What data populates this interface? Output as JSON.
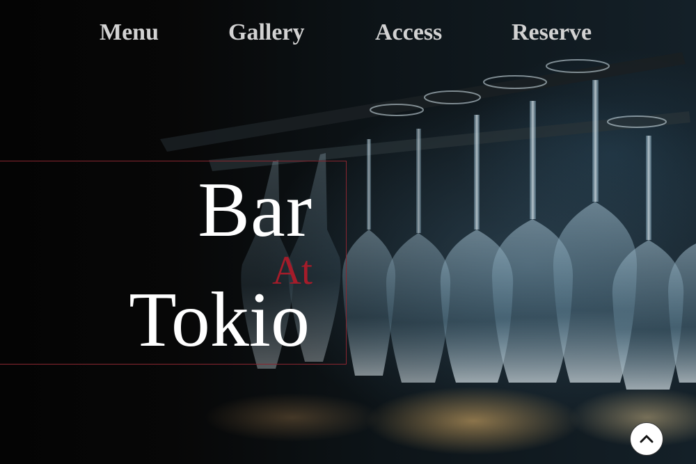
{
  "nav": {
    "items": [
      {
        "label": "Menu"
      },
      {
        "label": "Gallery"
      },
      {
        "label": "Access"
      },
      {
        "label": "Reserve"
      }
    ]
  },
  "hero": {
    "logo_line1": "Bar",
    "logo_line2": "At",
    "logo_line3": "Tokio",
    "background": "bar-wine-glasses-photo"
  },
  "back_to_top": {
    "icon": "chevron-up-icon"
  },
  "colors": {
    "background": "#050505",
    "nav_text": "#d2d2d2",
    "logo_text": "#ffffff",
    "accent_red": "#a51c2a",
    "box_border": "#8a2630",
    "button_bg": "#ffffff"
  }
}
